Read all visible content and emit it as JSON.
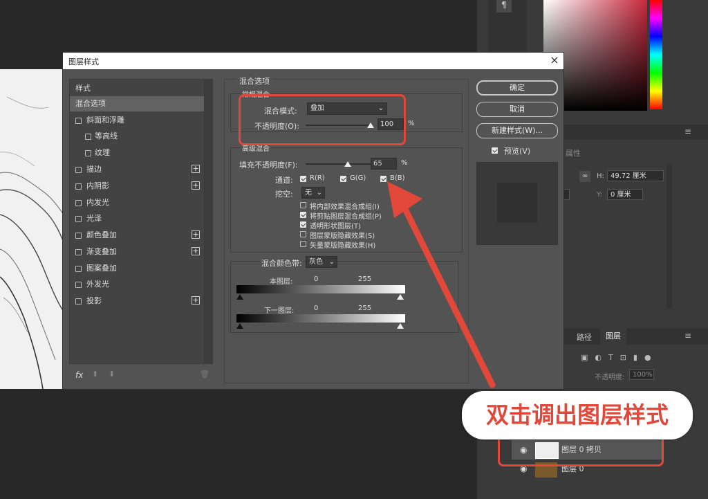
{
  "dialog": {
    "title": "图层样式",
    "close": "×",
    "styles_header": "样式",
    "styles": [
      {
        "label": "混合选项",
        "selected": true,
        "has_checkbox": false,
        "has_plus": false
      },
      {
        "label": "斜面和浮雕",
        "has_checkbox": true,
        "has_plus": false
      },
      {
        "label": "等高线",
        "has_checkbox": true,
        "indent": true
      },
      {
        "label": "纹理",
        "has_checkbox": true,
        "indent": true
      },
      {
        "label": "描边",
        "has_checkbox": true,
        "has_plus": true
      },
      {
        "label": "内阴影",
        "has_checkbox": true,
        "has_plus": true
      },
      {
        "label": "内发光",
        "has_checkbox": true
      },
      {
        "label": "光泽",
        "has_checkbox": true
      },
      {
        "label": "颜色叠加",
        "has_checkbox": true,
        "has_plus": true
      },
      {
        "label": "渐变叠加",
        "has_checkbox": true,
        "has_plus": true
      },
      {
        "label": "图案叠加",
        "has_checkbox": true
      },
      {
        "label": "外发光",
        "has_checkbox": true
      },
      {
        "label": "投影",
        "has_checkbox": true,
        "has_plus": true
      }
    ],
    "footer_fx": "fx",
    "blend": {
      "section_title": "混合选项",
      "general_title": "常规混合",
      "mode_label": "混合模式:",
      "mode_value": "叠加",
      "opacity_label": "不透明度(O):",
      "opacity_value": "100",
      "opacity_unit": "%",
      "opacity_fraction": 1.0
    },
    "advanced": {
      "title": "高级混合",
      "fill_label": "填充不透明度(F):",
      "fill_value": "65",
      "fill_unit": "%",
      "fill_fraction": 0.65,
      "channels_label": "通道:",
      "channel_r": "R(R)",
      "channel_g": "G(G)",
      "channel_b": "B(B)",
      "knockout_label": "挖空:",
      "knockout_value": "无",
      "options": [
        {
          "label": "将内部效果混合成组(I)",
          "checked": false
        },
        {
          "label": "将剪贴图层混合成组(P)",
          "checked": true
        },
        {
          "label": "透明形状图层(T)",
          "checked": true
        },
        {
          "label": "图层蒙版隐藏效果(S)",
          "checked": false
        },
        {
          "label": "矢量蒙版隐藏效果(H)",
          "checked": false
        }
      ]
    },
    "blend_if": {
      "label": "混合颜色带:",
      "value": "灰色",
      "this_layer": "本图层:",
      "under_layer": "下一图层:",
      "min": "0",
      "max": "255"
    },
    "buttons": {
      "ok": "确定",
      "cancel": "取消",
      "new_style": "新建样式(W)...",
      "preview": "预览(V)"
    }
  },
  "right_panel": {
    "properties_title": "属性",
    "h_label": "H:",
    "h_value": "49.72 厘米",
    "y_label": "Y:",
    "y_value": "0 厘米",
    "tab_paths": "路径",
    "tab_layers": "图层",
    "opacity_label": "不透明度:",
    "opacity_value": "100%",
    "layers": [
      {
        "name": "图层 0 拷贝"
      },
      {
        "name": "图层 0"
      }
    ]
  },
  "annotation": {
    "callout": "双击调出图层样式",
    "color": "#e2483a"
  }
}
